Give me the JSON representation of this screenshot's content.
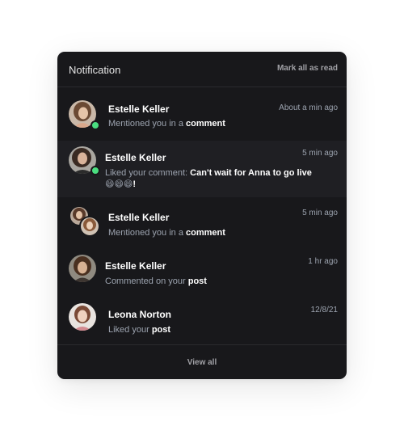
{
  "header": {
    "title": "Notification",
    "mark_all_label": "Mark all as read"
  },
  "notifications": [
    {
      "name": "Estelle Keller",
      "action": "Mentioned you in a",
      "target": "comment",
      "time": "About a min ago",
      "online": true,
      "avatar_icon": "woman-avatar-icon"
    },
    {
      "name": "Estelle Keller",
      "action": "Liked your comment:",
      "target": "Can't wait for Anna to go live",
      "emojis": "😄😄😄",
      "exclaim": "!",
      "time": "5 min ago",
      "online": true,
      "avatar_icon": "woman-avatar-icon"
    },
    {
      "name": "Estelle Keller",
      "action": "Mentioned you in a",
      "target": "comment",
      "time": "5 min ago",
      "online": false,
      "avatar_icon": "group-avatar-icon"
    },
    {
      "name": "Estelle Keller",
      "action": "Commented on your",
      "target": "post",
      "time": "1 hr ago",
      "online": false,
      "avatar_icon": "woman-avatar-icon"
    },
    {
      "name": "Leona Norton",
      "action": "Liked your",
      "target": "post",
      "time": "12/8/21",
      "online": false,
      "avatar_icon": "woman-avatar-icon"
    }
  ],
  "footer": {
    "view_all_label": "View all"
  },
  "colors": {
    "panel_bg": "#18181b",
    "highlight_bg": "#1f1f23",
    "online": "#4ade80",
    "muted_text": "#9ca3af"
  }
}
